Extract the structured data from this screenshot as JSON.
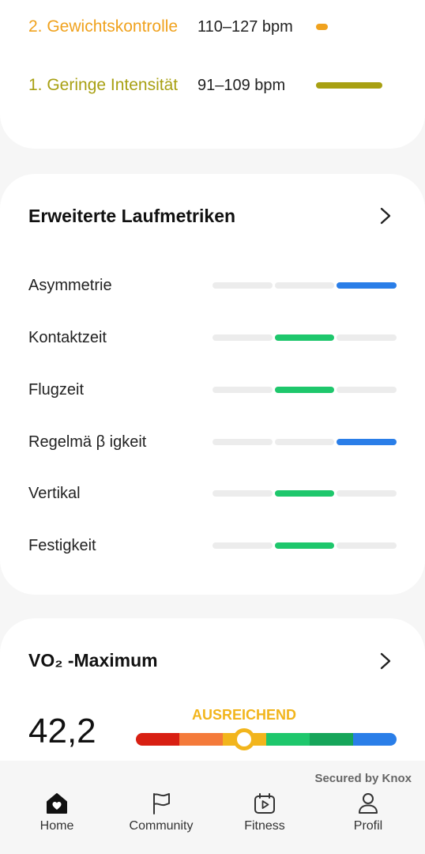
{
  "heart_zones": [
    {
      "name": "2. Gewichtskontrolle",
      "range": "110–127 bpm",
      "color": "#f0a21e",
      "fill_fraction": 0.08
    },
    {
      "name": "1. Geringe Intensität",
      "range": "91–109 bpm",
      "color": "#a8a012",
      "fill_fraction": 0.84
    }
  ],
  "running_metrics": {
    "title": "Erweiterte Laufmetriken",
    "items": [
      {
        "label": "Asymmetrie",
        "level": 3,
        "status_color": "#2a7ee8"
      },
      {
        "label": "Kontaktzeit",
        "level": 2,
        "status_color": "#1ec76c"
      },
      {
        "label": "Flugzeit",
        "level": 2,
        "status_color": "#1ec76c"
      },
      {
        "label": "Regelmä β igkeit",
        "level": 3,
        "status_color": "#2a7ee8"
      },
      {
        "label": "Vertikal",
        "level": 2,
        "status_color": "#1ec76c"
      },
      {
        "label": "Festigkeit",
        "level": 2,
        "status_color": "#1ec76c"
      }
    ]
  },
  "vo2": {
    "title": "VO₂ -Maximum",
    "value": "42,2",
    "rating": "AUSREICHEND",
    "rating_color": "#f2b51c",
    "scale_colors": [
      "#d81f12",
      "#f47a3a",
      "#f2b51c",
      "#1ec76c",
      "#16a55a",
      "#2a7ee8"
    ],
    "marker_fraction": 0.41
  },
  "footer": {
    "secured_text": "Secured by Knox"
  },
  "nav": {
    "items": [
      {
        "label": "Home",
        "icon": "home-heart-icon"
      },
      {
        "label": "Community",
        "icon": "flag-icon"
      },
      {
        "label": "Fitness",
        "icon": "calendar-play-icon"
      },
      {
        "label": "Profil",
        "icon": "person-icon"
      }
    ]
  }
}
